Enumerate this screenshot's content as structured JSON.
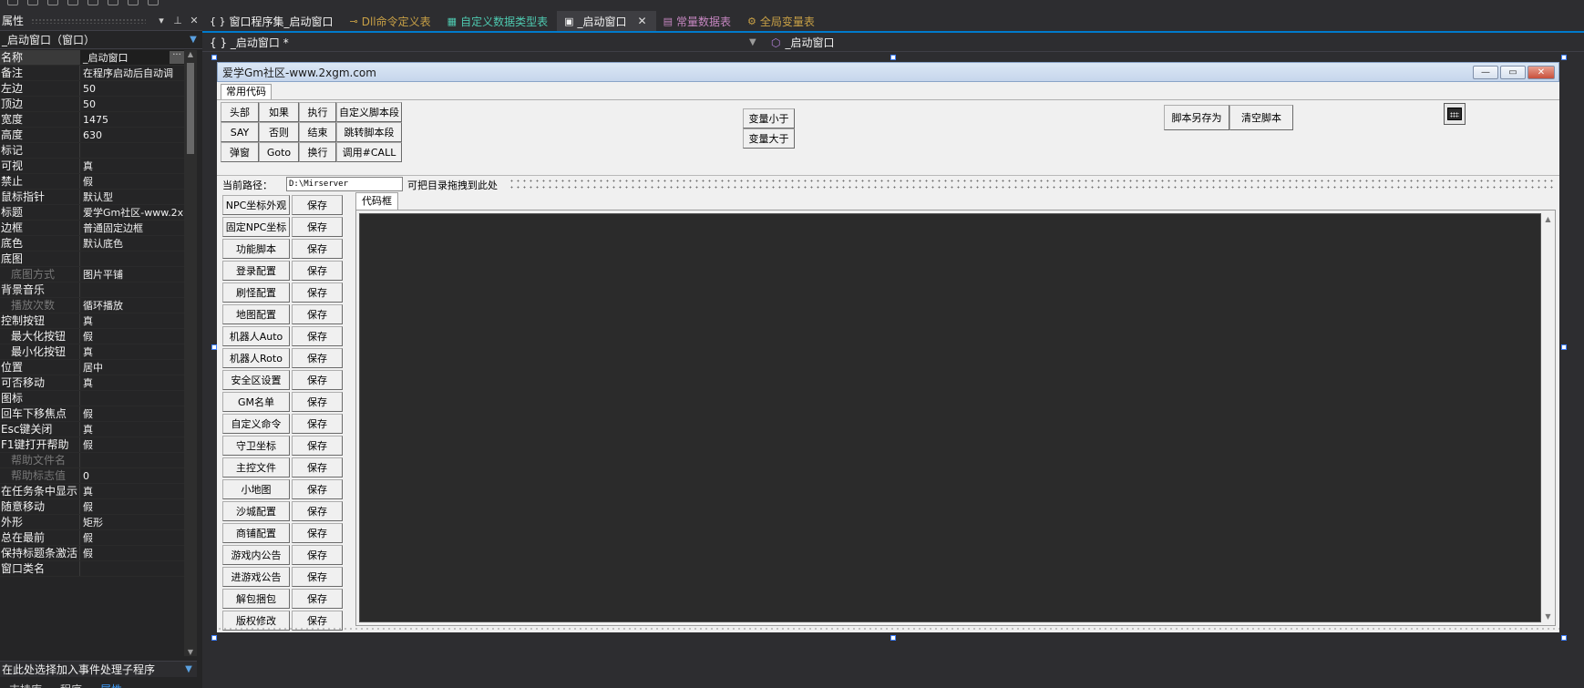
{
  "toolbar": {
    "glyphs": 8
  },
  "properties_panel": {
    "title": "属性",
    "pin_icon": "pin-icon",
    "object": "_启动窗口（窗口）",
    "rows": [
      {
        "name": "名称",
        "value": "_启动窗口"
      },
      {
        "name": "备注",
        "value": "在程序启动后自动调"
      },
      {
        "name": "左边",
        "value": "50"
      },
      {
        "name": "顶边",
        "value": "50"
      },
      {
        "name": "宽度",
        "value": "1475"
      },
      {
        "name": "高度",
        "value": "630"
      },
      {
        "name": "标记",
        "value": ""
      },
      {
        "name": "可视",
        "value": "真"
      },
      {
        "name": "禁止",
        "value": "假"
      },
      {
        "name": "鼠标指针",
        "value": "默认型"
      },
      {
        "name": "标题",
        "value": "爱学Gm社区-www.2xg"
      },
      {
        "name": "边框",
        "value": "普通固定边框"
      },
      {
        "name": "底色",
        "value": "默认底色"
      },
      {
        "name": "底图",
        "value": ""
      },
      {
        "name": "底图方式",
        "value": "图片平铺"
      },
      {
        "name": "背景音乐",
        "value": ""
      },
      {
        "name": "播放次数",
        "value": "循环播放"
      },
      {
        "name": "控制按钮",
        "value": "真"
      },
      {
        "name": "最大化按钮",
        "value": "假"
      },
      {
        "name": "最小化按钮",
        "value": "真"
      },
      {
        "name": "位置",
        "value": "居中"
      },
      {
        "name": "可否移动",
        "value": "真"
      },
      {
        "name": "图标",
        "value": ""
      },
      {
        "name": "回车下移焦点",
        "value": "假"
      },
      {
        "name": "Esc键关闭",
        "value": "真"
      },
      {
        "name": "F1键打开帮助",
        "value": "假"
      },
      {
        "name": "帮助文件名",
        "value": ""
      },
      {
        "name": "帮助标志值",
        "value": "0"
      },
      {
        "name": "在任务条中显示",
        "value": "真"
      },
      {
        "name": "随意移动",
        "value": "假"
      },
      {
        "name": "外形",
        "value": "矩形"
      },
      {
        "name": "总在最前",
        "value": "假"
      },
      {
        "name": "保持标题条激活",
        "value": "假"
      },
      {
        "name": "窗口类名",
        "value": ""
      }
    ],
    "event_hint": "在此处选择加入事件处理子程序",
    "bottom_tabs": [
      "支持库",
      "程序",
      "属性"
    ]
  },
  "doc_tabs": [
    {
      "icon": "{ }",
      "label": "窗口程序集_启动窗口",
      "color": "#f1f1f1"
    },
    {
      "icon": "⊸",
      "label": "Dll命令定义表",
      "color": "#c8a046"
    },
    {
      "icon": "▦",
      "label": "自定义数据类型表",
      "color": "#4ec9b0"
    },
    {
      "icon": "▣",
      "label": "_启动窗口",
      "color": "#f1f1f1"
    },
    {
      "icon": "▤",
      "label": "常量数据表",
      "color": "#c586c0"
    },
    {
      "icon": "⚙",
      "label": "全局变量表",
      "color": "#c8a046"
    }
  ],
  "nav": {
    "left": "{ }  _启动窗口 *",
    "right": "_启动窗口"
  },
  "form": {
    "title": "爱学Gm社区-www.2xgm.com",
    "tab": "常用代码",
    "cmd_buttons": [
      [
        "头部",
        "如果",
        "执行",
        "自定义脚本段"
      ],
      [
        "SAY",
        "否则",
        "结束",
        "跳转脚本段"
      ],
      [
        "弹窗",
        "Goto",
        "换行",
        "调用#CALL"
      ]
    ],
    "var_buttons": [
      "变量小于",
      "变量大于"
    ],
    "script_buttons": [
      "脚本另存为",
      "清空脚本"
    ],
    "path_label": "当前路径：",
    "path_value": "D:\\Mirserver",
    "path_hint": "可把目录拖拽到此处",
    "code_tab": "代码框",
    "save_label": "保存",
    "config_items": [
      "NPC坐标外观",
      "固定NPC坐标",
      "功能脚本",
      "登录配置",
      "刷怪配置",
      "地图配置",
      "机器人Auto",
      "机器人Roto",
      "安全区设置",
      "GM名单",
      "自定义命令",
      "守卫坐标",
      "主控文件",
      "小地图",
      "沙城配置",
      "商铺配置",
      "游戏内公告",
      "进游戏公告",
      "解包捆包",
      "版权修改"
    ]
  }
}
